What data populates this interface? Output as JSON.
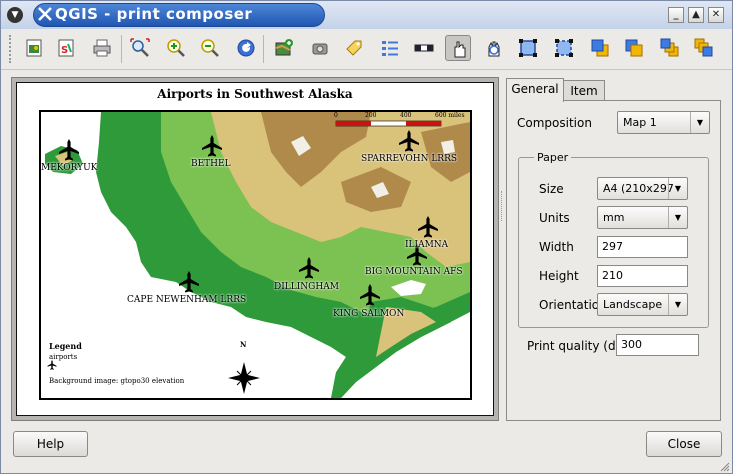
{
  "window": {
    "title": "QGIS - print composer"
  },
  "toolbar": {
    "buttons": [
      "export-image-icon",
      "export-svg-icon",
      "print-icon",
      "zoom-full-icon",
      "zoom-in-icon",
      "zoom-out-icon",
      "refresh-icon",
      "add-map-icon",
      "add-image-icon",
      "add-label-icon",
      "add-legend-icon",
      "add-scalebar-icon",
      "select-move-icon",
      "move-content-icon",
      "group-icon",
      "ungroup-icon",
      "raise-icon",
      "lower-icon",
      "move-top-icon",
      "move-bottom-icon"
    ],
    "pressed": "select-move-icon"
  },
  "composition": {
    "title": "Airports in Southwest Alaska",
    "scalebar": {
      "labels": [
        "0",
        "200",
        "400",
        "600 miles"
      ]
    },
    "airports": [
      {
        "name": "MEKORYUK"
      },
      {
        "name": "BETHEL"
      },
      {
        "name": "SPARREVOHN LRRS"
      },
      {
        "name": "ILIAMNA"
      },
      {
        "name": "BIG MOUNTAIN AFS"
      },
      {
        "name": "DILLINGHAM"
      },
      {
        "name": "CAPE NEWENHAM LRRS"
      },
      {
        "name": "KING SALMON"
      }
    ],
    "legend": {
      "title": "Legend",
      "layer": "airports",
      "background": "Background image: gtopo30 elevation"
    },
    "north_label": "N"
  },
  "panel": {
    "tabs": [
      "General",
      "Item"
    ],
    "active_tab": "General",
    "composition_label": "Composition",
    "composition_value": "Map 1",
    "paper_group": "Paper",
    "size_label": "Size",
    "size_value": "A4 (210x297",
    "units_label": "Units",
    "units_value": "mm",
    "width_label": "Width",
    "width_value": "297",
    "height_label": "Height",
    "height_value": "210",
    "orientation_label": "Orientation",
    "orientation_value": "Landscape",
    "quality_label": "Print quality (dpi)",
    "quality_value": "300"
  },
  "footer": {
    "help_label": "Help",
    "close_label": "Close"
  },
  "colors": {
    "title_bar": "#2f68c3",
    "sea": "#ffffff",
    "lowland": "#2e9a3a",
    "upland": "#d9c27a",
    "mountain": "#b08a4a",
    "scale_red": "#cc1111"
  }
}
